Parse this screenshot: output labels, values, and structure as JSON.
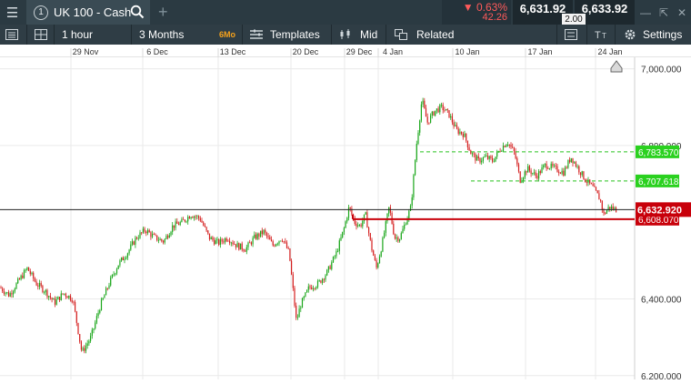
{
  "topbar": {
    "menu_icon": "hamburger-icon",
    "tab_number": "1",
    "instrument": "UK 100 - Cash",
    "add_tab": "+",
    "change_pct": "0.63%",
    "change_abs": "42.26",
    "bid": "6,631.92",
    "ask": "6,633.92",
    "spread": "2.00"
  },
  "toolbar": {
    "interval": "1 hour",
    "range": "3 Months",
    "range_badge": "6Mo",
    "templates": "Templates",
    "price_type": "Mid",
    "related": "Related",
    "settings": "Settings"
  },
  "chart_data": {
    "type": "candlestick",
    "x_tick_labels": [
      "29 Nov",
      "6 Dec",
      "13 Dec",
      "20 Dec",
      "29 Dec",
      "4 Jan",
      "10 Jan",
      "17 Jan",
      "24 Jan"
    ],
    "y_tick_labels": [
      "7,000.000",
      "6,800.000",
      "6,400.000",
      "6,200.000"
    ],
    "ylim": [
      6190,
      7030
    ],
    "grid": true,
    "current_price_label": "6,632.920",
    "levels": [
      {
        "label": "6,783.570",
        "value": 6783.57,
        "color": "#27c21d",
        "style": "dashed"
      },
      {
        "label": "6,707.618",
        "value": 6707.62,
        "color": "#27c21d",
        "style": "dashed"
      },
      {
        "label": "6,608.070",
        "value": 6608.07,
        "color": "#c8000a",
        "style": "solid"
      }
    ],
    "price_path": [
      [
        0,
        6430
      ],
      [
        10,
        6410
      ],
      [
        20,
        6445
      ],
      [
        30,
        6480
      ],
      [
        40,
        6440
      ],
      [
        50,
        6420
      ],
      [
        60,
        6390
      ],
      [
        70,
        6415
      ],
      [
        80,
        6400
      ],
      [
        90,
        6260
      ],
      [
        100,
        6300
      ],
      [
        110,
        6380
      ],
      [
        120,
        6440
      ],
      [
        130,
        6490
      ],
      [
        140,
        6520
      ],
      [
        150,
        6560
      ],
      [
        160,
        6580
      ],
      [
        170,
        6560
      ],
      [
        180,
        6550
      ],
      [
        190,
        6590
      ],
      [
        200,
        6600
      ],
      [
        210,
        6620
      ],
      [
        220,
        6610
      ],
      [
        230,
        6560
      ],
      [
        240,
        6545
      ],
      [
        250,
        6560
      ],
      [
        260,
        6540
      ],
      [
        270,
        6530
      ],
      [
        280,
        6560
      ],
      [
        290,
        6575
      ],
      [
        300,
        6540
      ],
      [
        310,
        6560
      ],
      [
        318,
        6520
      ],
      [
        322,
        6430
      ],
      [
        326,
        6340
      ],
      [
        330,
        6380
      ],
      [
        340,
        6430
      ],
      [
        350,
        6440
      ],
      [
        360,
        6470
      ],
      [
        370,
        6520
      ],
      [
        378,
        6580
      ],
      [
        384,
        6640
      ],
      [
        390,
        6600
      ],
      [
        396,
        6590
      ],
      [
        402,
        6620
      ],
      [
        408,
        6540
      ],
      [
        414,
        6480
      ],
      [
        420,
        6540
      ],
      [
        428,
        6640
      ],
      [
        434,
        6560
      ],
      [
        440,
        6560
      ],
      [
        446,
        6600
      ],
      [
        452,
        6640
      ],
      [
        458,
        6800
      ],
      [
        464,
        6920
      ],
      [
        470,
        6860
      ],
      [
        478,
        6890
      ],
      [
        486,
        6900
      ],
      [
        494,
        6880
      ],
      [
        502,
        6840
      ],
      [
        510,
        6830
      ],
      [
        518,
        6780
      ],
      [
        526,
        6760
      ],
      [
        534,
        6770
      ],
      [
        542,
        6760
      ],
      [
        550,
        6790
      ],
      [
        558,
        6810
      ],
      [
        566,
        6780
      ],
      [
        572,
        6710
      ],
      [
        580,
        6740
      ],
      [
        590,
        6720
      ],
      [
        600,
        6750
      ],
      [
        610,
        6740
      ],
      [
        620,
        6730
      ],
      [
        628,
        6770
      ],
      [
        636,
        6740
      ],
      [
        644,
        6710
      ],
      [
        652,
        6690
      ],
      [
        660,
        6660
      ],
      [
        664,
        6620
      ],
      [
        670,
        6640
      ],
      [
        678,
        6632
      ]
    ]
  }
}
